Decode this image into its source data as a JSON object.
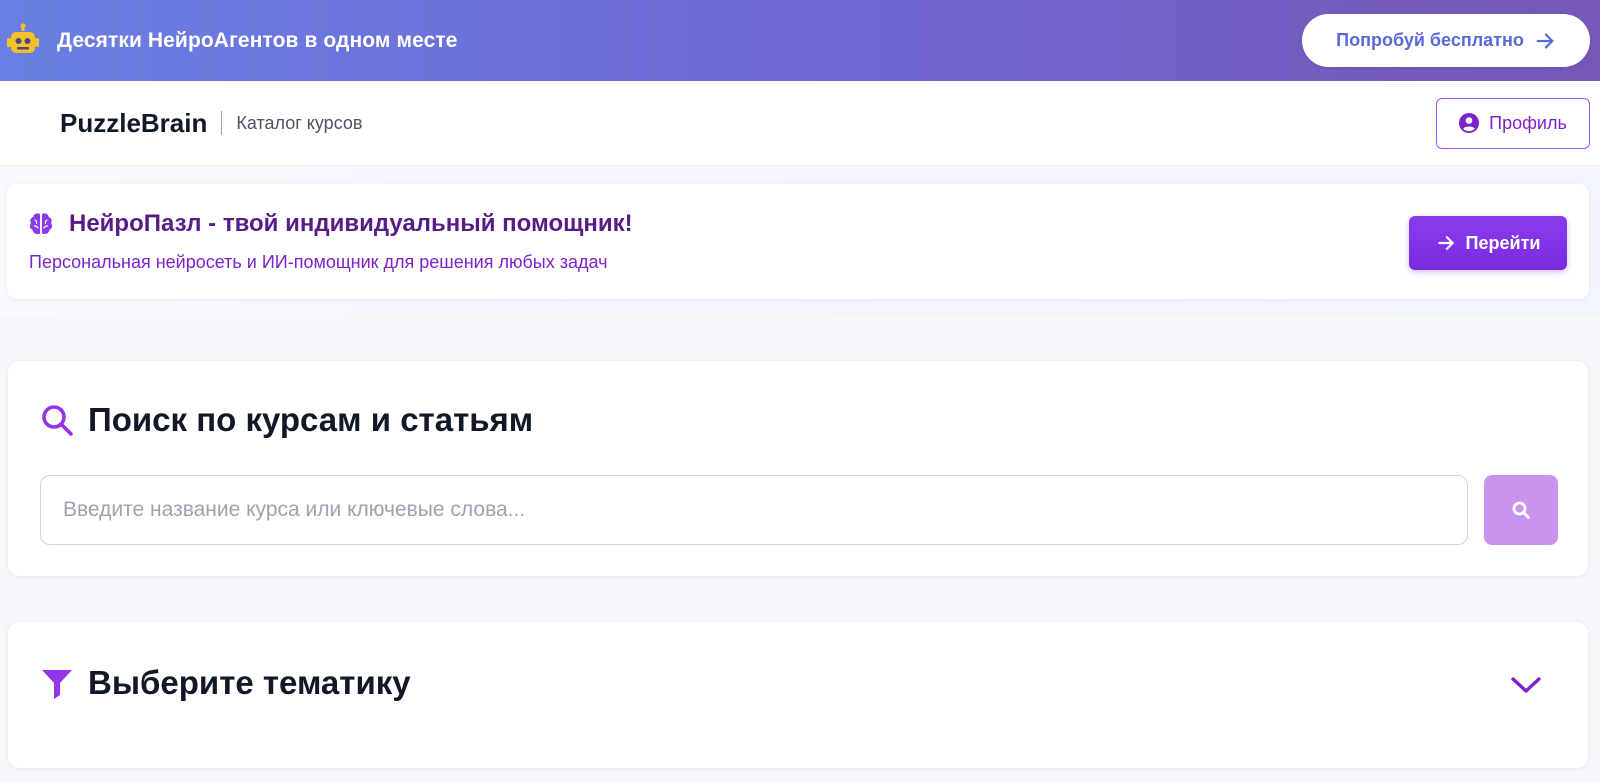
{
  "promo": {
    "title": "Десятки НейроАгентов в одном месте",
    "cta_label": "Попробуй бесплатно",
    "icon": "robot-icon"
  },
  "header": {
    "brand": "PuzzleBrain",
    "subtitle": "Каталог курсов",
    "profile_label": "Профиль"
  },
  "banner": {
    "title": "НейроПазл - твой индивидуальный помощник!",
    "subtitle": "Персональная нейросеть и ИИ-помощник для решения любых задач",
    "button_label": "Перейти",
    "icon": "brain-icon"
  },
  "search": {
    "title": "Поиск по курсам и статьям",
    "placeholder": "Введите название курса или ключевые слова...",
    "value": ""
  },
  "topics": {
    "title": "Выберите тематику",
    "expanded": false
  },
  "colors": {
    "accent": "#7c3aed",
    "accent_dark": "#581c87",
    "search_button": "#c894ee",
    "promo_gradient_start": "#6a7fe3",
    "promo_gradient_end": "#7658b8"
  }
}
